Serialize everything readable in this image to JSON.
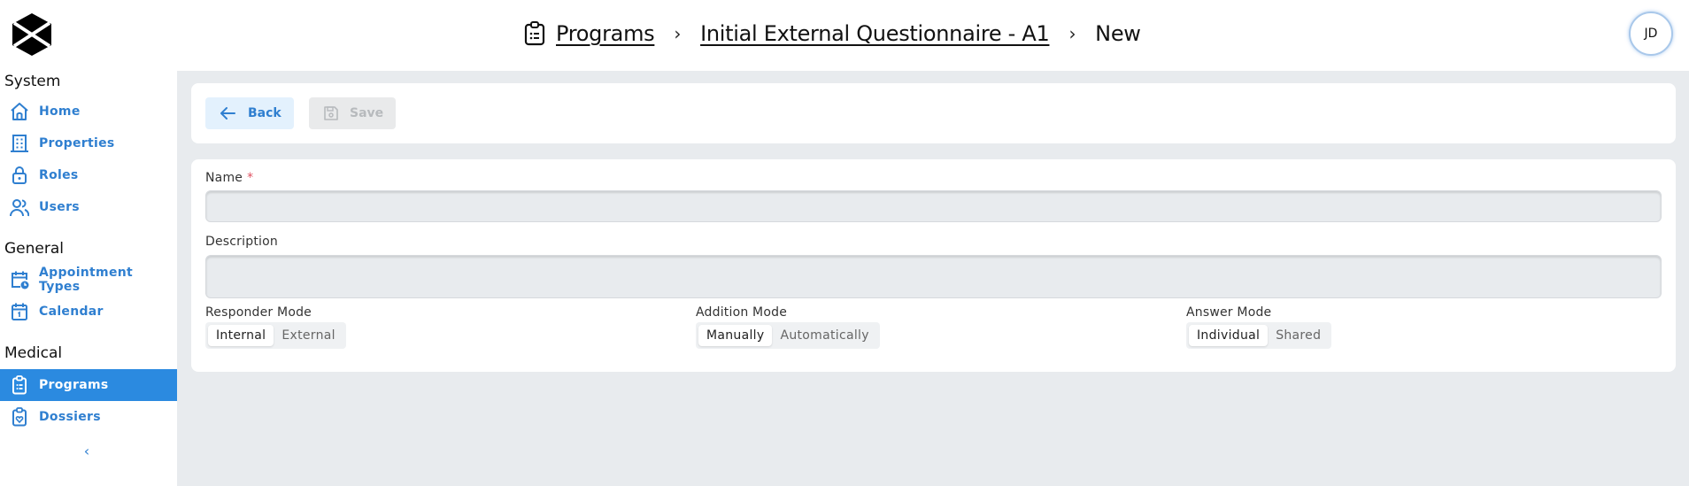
{
  "header": {
    "breadcrumb": {
      "icon": "clipboard-list-icon",
      "items": [
        {
          "label": "Programs",
          "link": true
        },
        {
          "label": "Initial External Questionnaire - A1",
          "link": true
        },
        {
          "label": "New",
          "link": false
        }
      ],
      "separator": "›"
    },
    "avatar_initials": "JD"
  },
  "sidebar": {
    "sections": [
      {
        "title": "System",
        "items": [
          {
            "label": "Home",
            "icon": "home-icon"
          },
          {
            "label": "Properties",
            "icon": "building-icon"
          },
          {
            "label": "Roles",
            "icon": "lock-icon"
          },
          {
            "label": "Users",
            "icon": "users-icon"
          }
        ]
      },
      {
        "title": "General",
        "items": [
          {
            "label": "Appointment Types",
            "icon": "calendar-clock-icon"
          },
          {
            "label": "Calendar",
            "icon": "calendar-icon"
          }
        ]
      },
      {
        "title": "Medical",
        "items": [
          {
            "label": "Programs",
            "icon": "clipboard-list-icon",
            "active": true
          },
          {
            "label": "Dossiers",
            "icon": "clipboard-heart-icon"
          }
        ]
      }
    ],
    "collapse_label": "‹"
  },
  "toolbar": {
    "back_label": "Back",
    "save_label": "Save",
    "save_disabled": true
  },
  "form": {
    "name": {
      "label": "Name",
      "required_mark": "*",
      "value": "",
      "placeholder": ""
    },
    "description": {
      "label": "Description",
      "value": "",
      "placeholder": ""
    },
    "responder_mode": {
      "label": "Responder Mode",
      "options": [
        "Internal",
        "External"
      ],
      "selected": "Internal"
    },
    "addition_mode": {
      "label": "Addition Mode",
      "options": [
        "Manually",
        "Automatically"
      ],
      "selected": "Manually"
    },
    "answer_mode": {
      "label": "Answer Mode",
      "options": [
        "Individual",
        "Shared"
      ],
      "selected": "Individual"
    }
  },
  "colors": {
    "accent": "#2b8ae0",
    "link_text": "#2f7fd0",
    "required": "#e05060",
    "background": "#e8ebee"
  }
}
